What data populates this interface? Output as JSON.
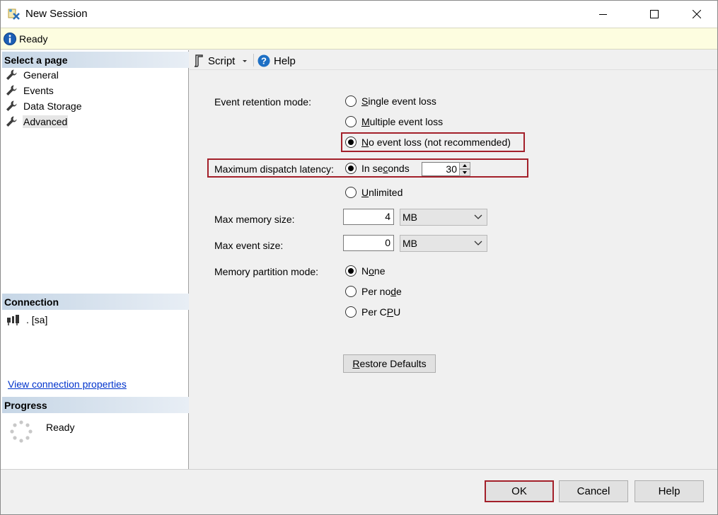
{
  "window": {
    "title": "New Session",
    "icon": "session-app-icon",
    "controls": [
      "minimize-icon",
      "maximize-icon",
      "close-icon"
    ]
  },
  "status": {
    "icon": "info-icon",
    "text": "Ready"
  },
  "left": {
    "select_page_header": "Select a page",
    "pages": [
      {
        "label": "General",
        "icon": "wrench-icon"
      },
      {
        "label": "Events",
        "icon": "wrench-icon"
      },
      {
        "label": "Data Storage",
        "icon": "wrench-icon"
      },
      {
        "label": "Advanced",
        "icon": "wrench-icon",
        "selected": true
      }
    ],
    "connection_header": "Connection",
    "connection_value": ". [sa]",
    "connection_link": "View connection properties",
    "progress_header": "Progress",
    "progress_text": "Ready"
  },
  "toolbar": {
    "script_label": "Script",
    "help_label": "Help"
  },
  "form": {
    "event_retention_label": "Event retention mode:",
    "retention_options": {
      "single_prefix": "",
      "single_ul": "S",
      "single_rest": "ingle event loss",
      "multiple_prefix": "",
      "multiple_ul": "M",
      "multiple_rest": "ultiple event loss",
      "no_loss_prefix": "",
      "no_loss_ul": "N",
      "no_loss_rest": "o event loss (not recommended)"
    },
    "retention_selected": "No event loss (not recommended)",
    "dispatch_label": "Maximum dispatch latency:",
    "dispatch_seconds_prefix": "In se",
    "dispatch_seconds_ul": "c",
    "dispatch_seconds_rest": "onds",
    "dispatch_value": "30",
    "dispatch_unlimited_ul": "U",
    "dispatch_unlimited_rest": "nlimited",
    "dispatch_selected": "In seconds",
    "max_memory_label": "Max memory size:",
    "max_memory_value": "4",
    "max_memory_unit": "MB",
    "max_event_label": "Max event size:",
    "max_event_value": "0",
    "max_event_unit": "MB",
    "partition_label": "Memory partition mode:",
    "partition_none_prefix": "N",
    "partition_none_ul": "o",
    "partition_none_rest": "ne",
    "partition_node_prefix": "Per no",
    "partition_node_ul": "d",
    "partition_node_rest": "e",
    "partition_cpu_prefix": "Per C",
    "partition_cpu_ul": "P",
    "partition_cpu_rest": "U",
    "partition_selected": "None",
    "restore_ul": "R",
    "restore_rest": "estore Defaults"
  },
  "buttons": {
    "ok": "OK",
    "cancel": "Cancel",
    "help": "Help"
  },
  "colors": {
    "highlight_border": "#a3202a",
    "status_bg": "#fdfde0",
    "link": "#0033cc"
  }
}
